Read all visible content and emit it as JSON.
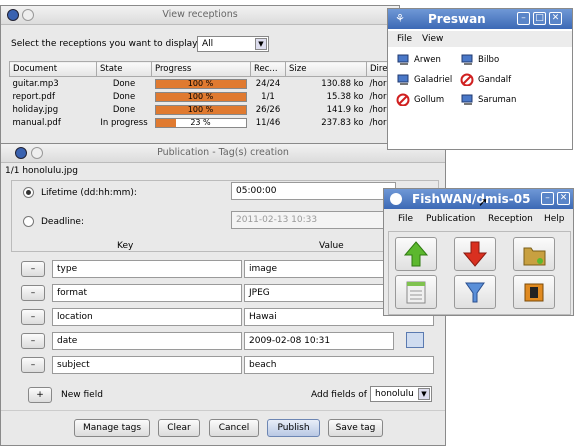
{
  "receptions": {
    "title": "View receptions",
    "select_label": "Select the receptions you want to display:",
    "filter_value": "All",
    "columns": [
      "Document",
      "State",
      "Progress",
      "Rec...",
      "Size",
      "Dire"
    ],
    "rows": [
      {
        "document": "guitar.mp3",
        "state": "Done",
        "progress": 1.0,
        "progress_label": "100 %",
        "rec": "24/24",
        "size": "130.88 ko",
        "dir": "/hor"
      },
      {
        "document": "report.pdf",
        "state": "Done",
        "progress": 1.0,
        "progress_label": "100 %",
        "rec": "1/1",
        "size": "15.38 ko",
        "dir": "/hor"
      },
      {
        "document": "holiday.jpg",
        "state": "Done",
        "progress": 1.0,
        "progress_label": "100 %",
        "rec": "26/26",
        "size": "141.9 ko",
        "dir": "/hor"
      },
      {
        "document": "manual.pdf",
        "state": "In progress",
        "progress": 0.23,
        "progress_label": "23 %",
        "rec": "11/46",
        "size": "237.83 ko",
        "dir": "/hor"
      }
    ]
  },
  "publication": {
    "title": "Publication - Tag(s) creation",
    "file_label": "1/1 honolulu.jpg",
    "lifetime_label": "Lifetime (dd:hh:mm):",
    "lifetime_value": "05:00:00",
    "deadline_label": "Deadline:",
    "deadline_value": "2011-02-13 10:33",
    "key_header": "Key",
    "value_header": "Value",
    "tags": [
      {
        "key": "type",
        "value": "image"
      },
      {
        "key": "format",
        "value": "JPEG"
      },
      {
        "key": "location",
        "value": "Hawai"
      },
      {
        "key": "date",
        "value": "2009-02-08 10:31"
      },
      {
        "key": "subject",
        "value": "beach"
      }
    ],
    "remove_symbol": "–",
    "add_symbol": "+",
    "new_field_label": "New field",
    "add_fields_label": "Add fields of",
    "add_fields_value": "honolulu",
    "buttons": {
      "manage": "Manage tags",
      "clear": "Clear",
      "cancel": "Cancel",
      "publish": "Publish",
      "save": "Save tag"
    }
  },
  "preswan": {
    "title": "Preswan",
    "menu": [
      "File",
      "View"
    ],
    "users": [
      "Arwen",
      "Bilbo",
      "Galadriel",
      "Gandalf",
      "Gollum",
      "Saruman"
    ],
    "user_status": [
      "online",
      "online",
      "online",
      "blocked",
      "blocked",
      "online"
    ]
  },
  "fishwan": {
    "title": "FishWAN/dmis-05",
    "menu": [
      "File",
      "Publication",
      "Reception",
      "Help"
    ],
    "actions": [
      "up-arrow",
      "down-arrow",
      "folder",
      "list",
      "filter",
      "stop"
    ]
  },
  "colors": {
    "progress": "#e07a30",
    "title_blue": "#3c69b5",
    "green": "#5cb82e",
    "red": "#d93020"
  }
}
